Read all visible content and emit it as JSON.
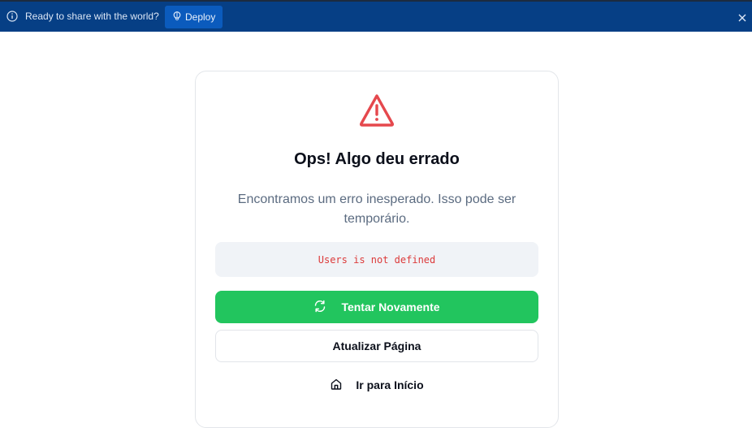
{
  "banner": {
    "message": "Ready to share with the world?",
    "deploy_label": "Deploy",
    "info_icon": "info-icon",
    "deploy_icon": "balloon-icon",
    "close_icon": "close-icon",
    "background_color": "#063f85"
  },
  "error_card": {
    "icon": "warning-triangle-icon",
    "title": "Ops! Algo deu errado",
    "description": "Encontramos um erro inesperado. Isso pode ser temporário.",
    "error_message": "Users is not defined",
    "retry_label": "Tentar Novamente",
    "retry_icon": "refresh-icon",
    "reload_label": "Atualizar Página",
    "home_label": "Ir para Início",
    "home_icon": "home-icon",
    "accent_color": "#22c55e",
    "error_color": "#dc3a3a"
  }
}
